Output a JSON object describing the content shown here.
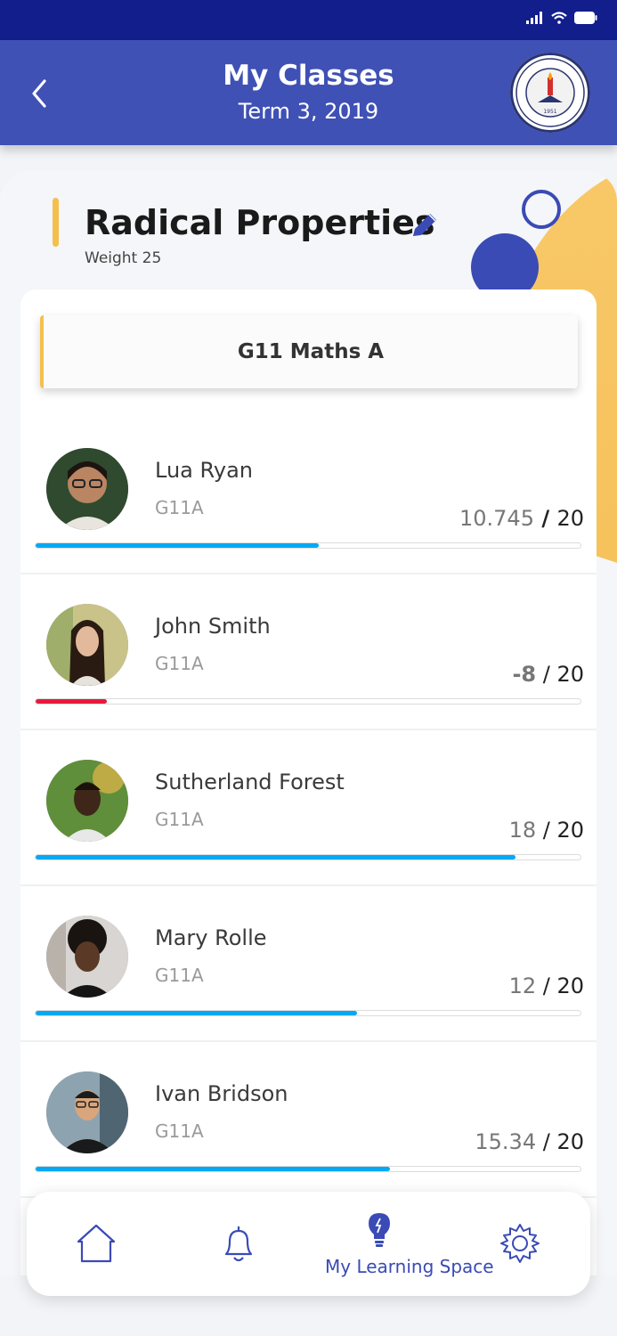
{
  "header": {
    "title": "My Classes",
    "subtitle": "Term 3, 2019",
    "back_icon": "chevron-left-icon",
    "logo": "school-seal-logo"
  },
  "topic": {
    "title": "Radical Properties",
    "weight": "Weight 25",
    "edit_icon": "pencil-icon"
  },
  "class_tab": {
    "label": "G11 Maths A"
  },
  "students": [
    {
      "name": "Lua Ryan",
      "class": "G11A",
      "score": "10.745",
      "total": "20",
      "progress": 0.52,
      "color": "#03a9f4"
    },
    {
      "name": "John Smith",
      "class": "G11A",
      "score": "-8",
      "total": "20",
      "progress": 0.13,
      "color": "#e8193c"
    },
    {
      "name": "Sutherland Forest",
      "class": "G11A",
      "score": "18",
      "total": "20",
      "progress": 0.88,
      "color": "#03a9f4"
    },
    {
      "name": "Mary Rolle",
      "class": "G11A",
      "score": "12",
      "total": "20",
      "progress": 0.59,
      "color": "#03a9f4"
    },
    {
      "name": "Ivan Bridson",
      "class": "G11A",
      "score": "15.34",
      "total": "20",
      "progress": 0.65,
      "color": "#03a9f4"
    }
  ],
  "nav": {
    "items": [
      "home-icon",
      "bell-icon",
      "lightbulb-icon",
      "gear-icon"
    ],
    "active_label": "My Learning Space"
  },
  "colors": {
    "header": "#3f51b5",
    "status_bar": "#121e8c",
    "accent_yellow": "#f4c04d",
    "progress_blue": "#03a9f4",
    "progress_red": "#e8193c"
  }
}
